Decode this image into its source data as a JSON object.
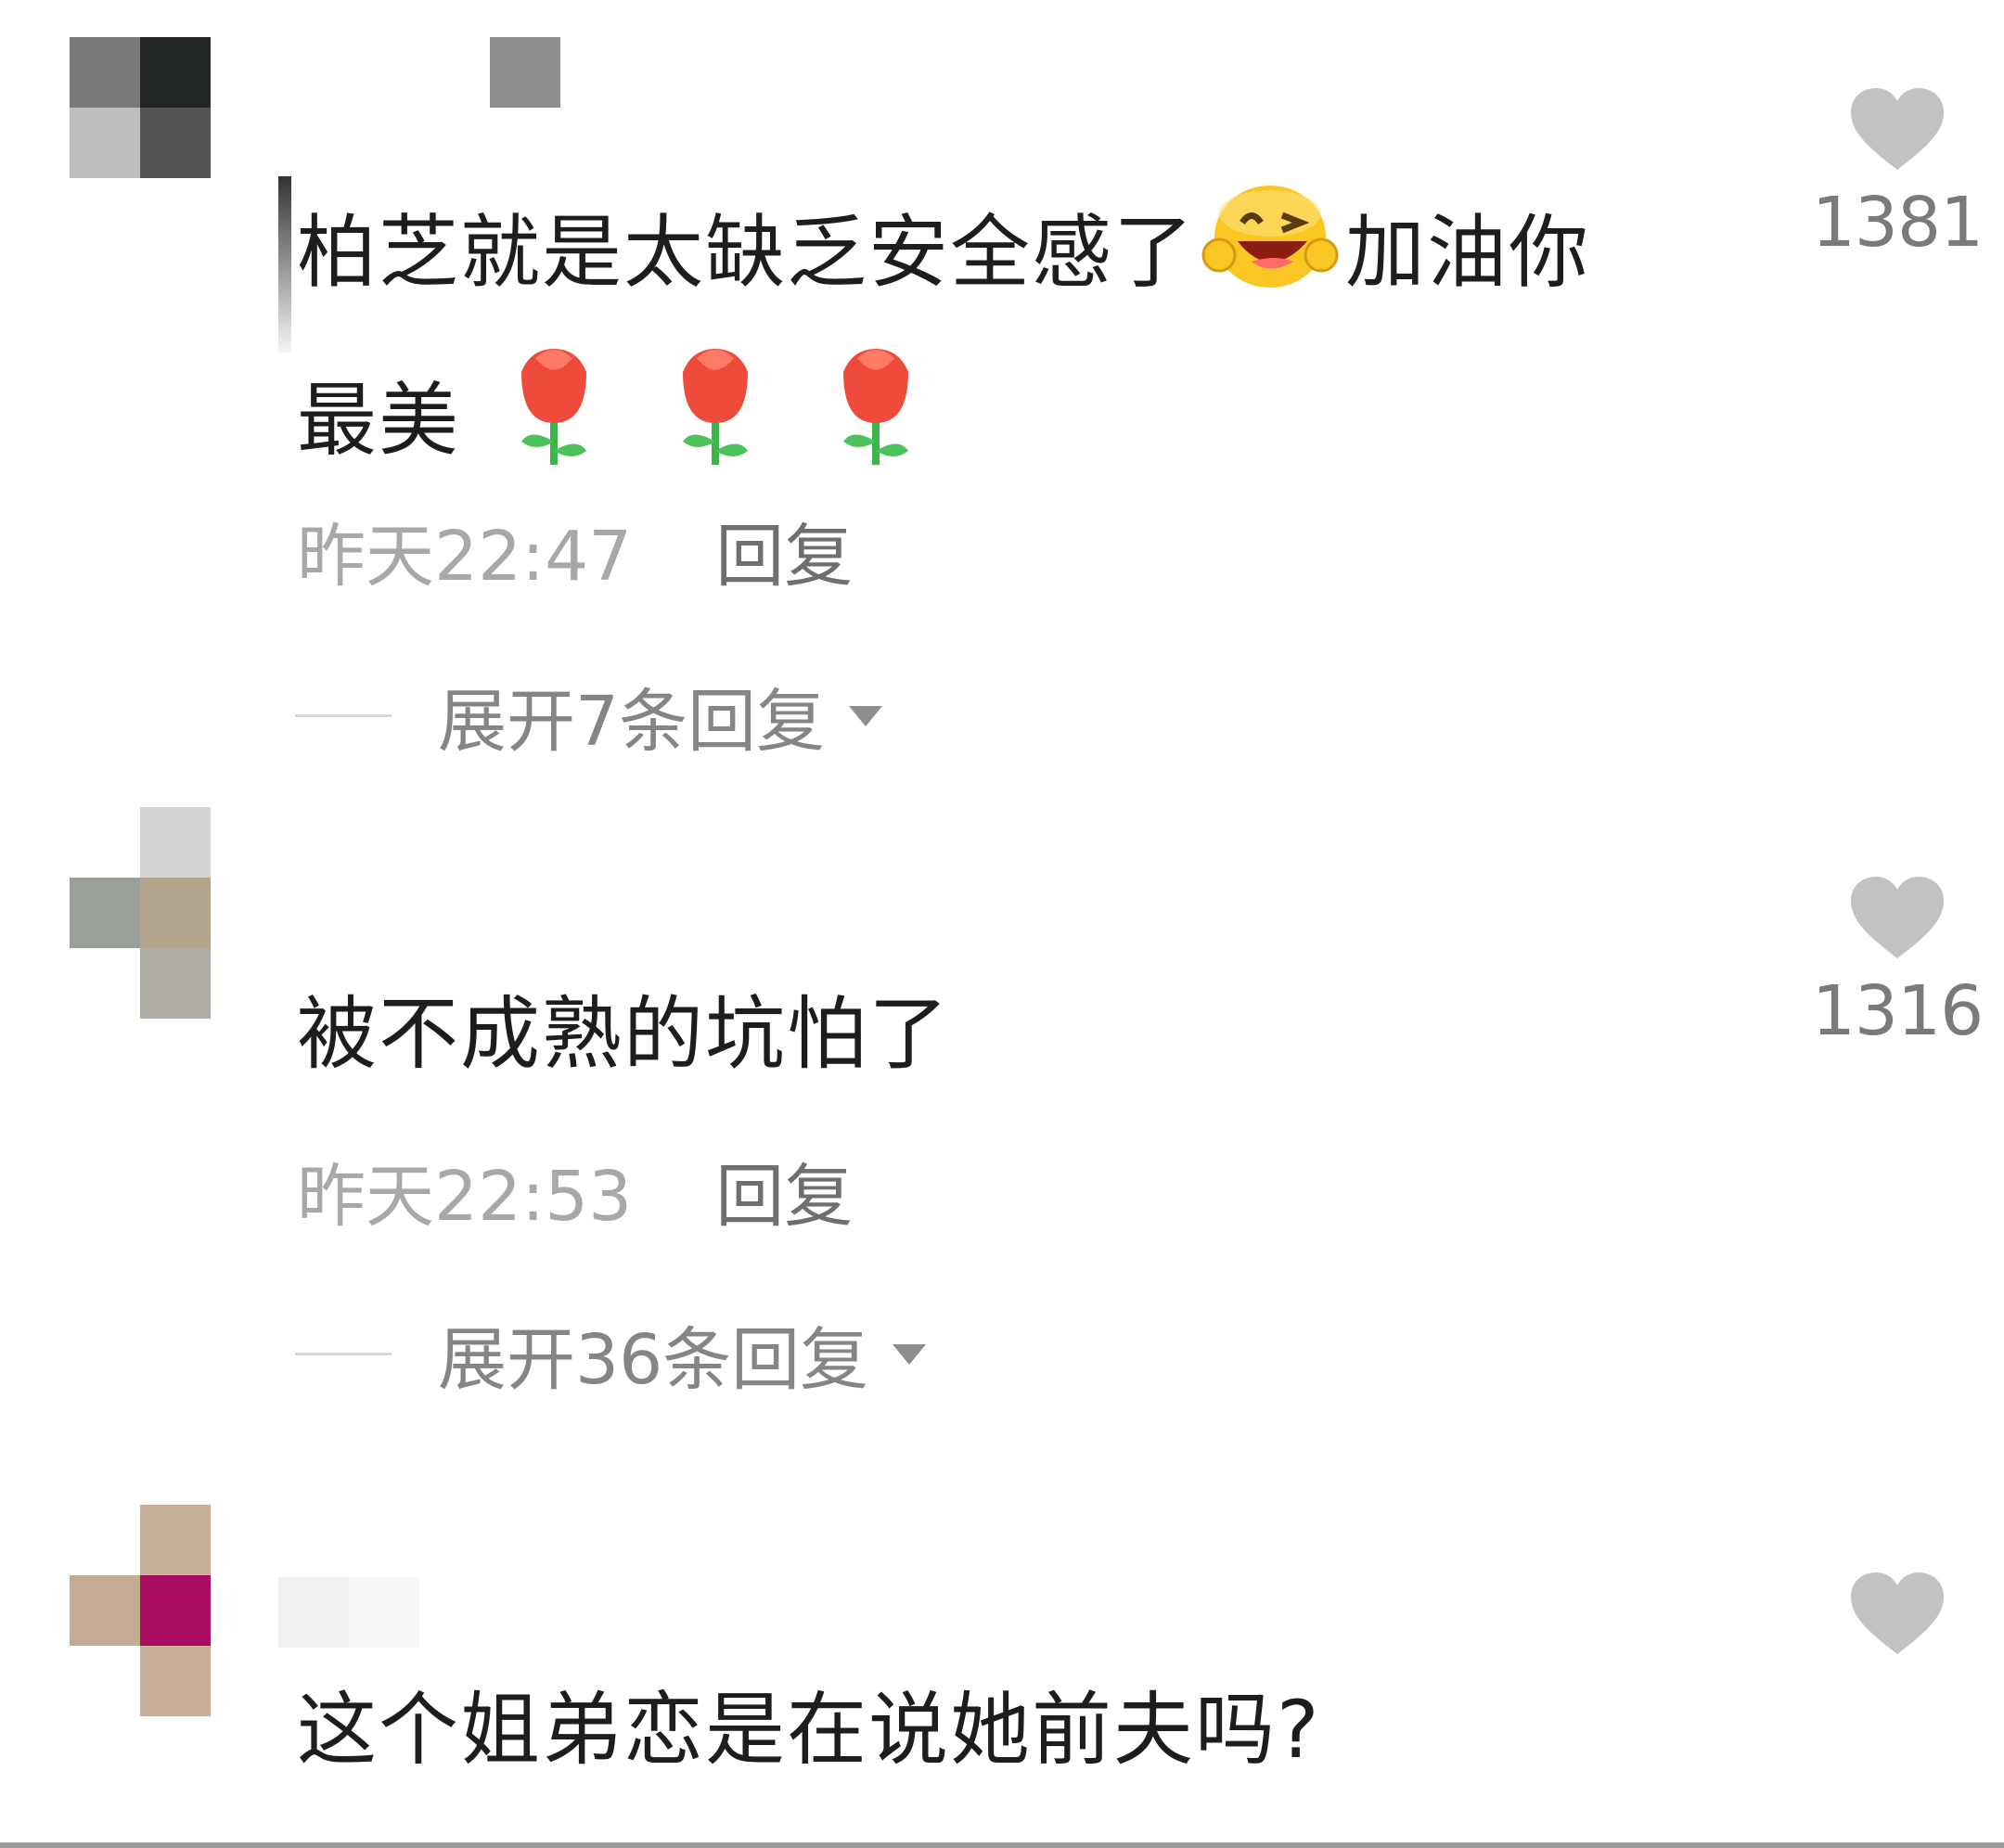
{
  "comments": [
    {
      "avatar_colors": [
        "#7a7a7a",
        "#222624",
        "#bdbdbd",
        "#545454"
      ],
      "name_blur_colors": [
        "#8f8f92"
      ],
      "text_line1": "柏芝就是太缺乏安全感了",
      "text_line1_after_emoji": "加油你",
      "text_line2": "最美",
      "emoji_icons": [
        "grinning-wink-emoji-icon",
        "rose-emoji-icon",
        "rose-emoji-icon",
        "rose-emoji-icon"
      ],
      "time": "昨天22:47",
      "reply_label": "回复",
      "expand_label": "展开7条回复",
      "likes": "1381"
    },
    {
      "avatar_colors": [
        "#d2d4d2",
        "#9aa097",
        "#b3a48d",
        "#aeaca4"
      ],
      "text": "被不成熟的坑怕了",
      "time": "昨天22:53",
      "reply_label": "回复",
      "expand_label": "展开36条回复",
      "likes": "1316"
    },
    {
      "avatar_colors": [
        "#c7ae96",
        "#c6ab94",
        "#a80c5f",
        "#c8ae98"
      ],
      "name_blur_colors": [
        "#f1f1f1",
        "#f7f7f7"
      ],
      "text": "这个姐弟恋是在说她前夫吗?"
    }
  ],
  "colors": {
    "heart": "#c2c2c2",
    "text": "#1d1d1f",
    "meta": "#a8a8a8"
  }
}
